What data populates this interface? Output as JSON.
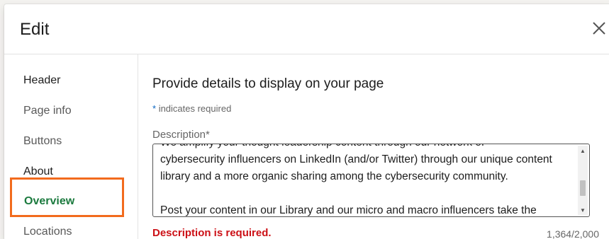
{
  "modal": {
    "title": "Edit",
    "close_icon": "close-icon"
  },
  "sidebar": {
    "sections": [
      {
        "label": "Header"
      },
      {
        "label": "About"
      }
    ],
    "items": [
      {
        "label": "Page info"
      },
      {
        "label": "Buttons"
      },
      {
        "label": "Overview",
        "active": true
      },
      {
        "label": "Locations"
      }
    ],
    "highlight_color": "#f26b1d",
    "active_color": "#1b7a3e"
  },
  "main": {
    "heading": "Provide details to display on your page",
    "required_note_star": "*",
    "required_note": "indicates required",
    "description": {
      "label": "Description",
      "required_marker": "*",
      "value": "We amplify your thought leadership content through our network of\ncybersecurity influencers on LinkedIn (and/or Twitter) through our unique content\nlibrary and a more organic sharing among the cybersecurity community.\n\nPost your content in our Library and our micro and macro influencers take the",
      "scroll_position": 0.72,
      "error": "Description is required.",
      "counter": "1,364/2,000"
    }
  },
  "colors": {
    "error": "#cc1016",
    "link_blue": "#0a66c2"
  }
}
